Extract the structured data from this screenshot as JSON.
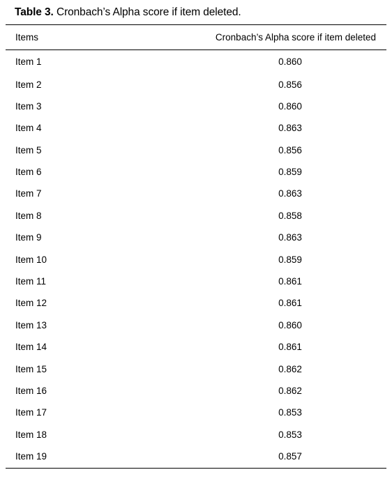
{
  "caption": {
    "label": "Table 3.",
    "text": " Cronbach’s Alpha score if item deleted."
  },
  "table": {
    "columns": [
      {
        "key": "items",
        "header": "Items",
        "align": "left"
      },
      {
        "key": "score",
        "header": "Cronbach’s Alpha score if item deleted",
        "align": "center"
      }
    ],
    "rows": [
      {
        "item": "Item 1",
        "score": "0.860"
      },
      {
        "item": "Item 2",
        "score": "0.856"
      },
      {
        "item": "Item 3",
        "score": "0.860"
      },
      {
        "item": "Item 4",
        "score": "0.863"
      },
      {
        "item": "Item 5",
        "score": "0.856"
      },
      {
        "item": "Item 6",
        "score": "0.859"
      },
      {
        "item": "Item 7",
        "score": "0.863"
      },
      {
        "item": "Item 8",
        "score": "0.858"
      },
      {
        "item": "Item 9",
        "score": "0.863"
      },
      {
        "item": "Item 10",
        "score": "0.859"
      },
      {
        "item": "Item 11",
        "score": "0.861"
      },
      {
        "item": "Item 12",
        "score": "0.861"
      },
      {
        "item": "Item 13",
        "score": "0.860"
      },
      {
        "item": "Item 14",
        "score": "0.861"
      },
      {
        "item": "Item 15",
        "score": "0.862"
      },
      {
        "item": "Item 16",
        "score": "0.862"
      },
      {
        "item": "Item 17",
        "score": "0.853"
      },
      {
        "item": "Item 18",
        "score": "0.853"
      },
      {
        "item": "Item 19",
        "score": "0.857"
      }
    ]
  },
  "colors": {
    "text": "#000000",
    "rule": "#000000",
    "background": "#ffffff"
  }
}
